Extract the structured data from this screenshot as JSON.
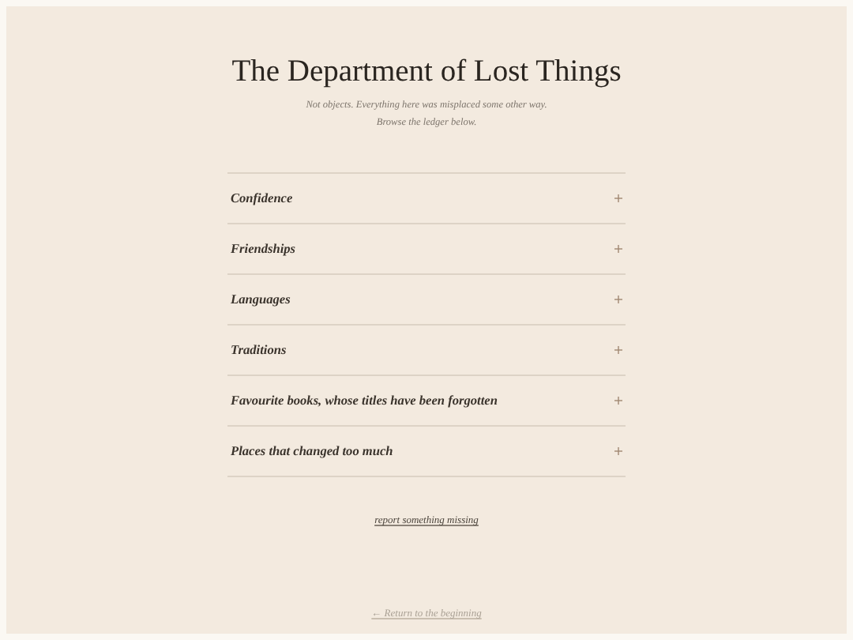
{
  "header": {
    "title": "The Department of Lost Things",
    "subtitle_lines": [
      "Not objects. Everything here was misplaced some other way.",
      "Browse the ledger below."
    ]
  },
  "items": [
    {
      "label": "Confidence",
      "expanded": false
    },
    {
      "label": "Friendships",
      "expanded": false
    },
    {
      "label": "Languages",
      "expanded": false
    },
    {
      "label": "Traditions",
      "expanded": false
    },
    {
      "label": "Favourite books, whose titles have been forgotten",
      "expanded": false
    },
    {
      "label": "Places that changed too much",
      "expanded": false
    }
  ],
  "report_link": "report something missing",
  "footer_link": "← Return to the beginning"
}
